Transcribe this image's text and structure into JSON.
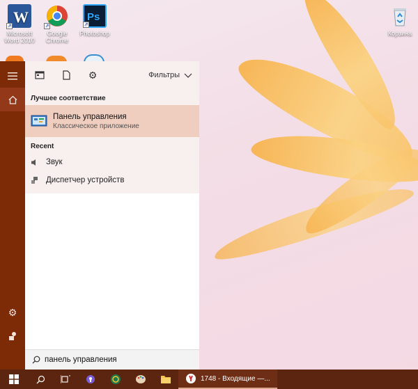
{
  "desktop": {
    "icons": [
      {
        "label": "Microsoft Word 2010"
      },
      {
        "label": "Google Chrome"
      },
      {
        "label": "Photoshop"
      },
      {
        "label": "Корзина"
      }
    ]
  },
  "panel": {
    "filters_label": "Фильтры",
    "best_match_header": "Лучшее соответствие",
    "best_match": {
      "title": "Панель управления",
      "subtitle": "Классическое приложение"
    },
    "recent_header": "Recent",
    "recent": [
      {
        "label": "Звук",
        "icon": "speaker-icon"
      },
      {
        "label": "Диспетчер устройств",
        "icon": "device-manager-icon"
      }
    ]
  },
  "search": {
    "query": "панель управления"
  },
  "taskbar": {
    "active_window_title": "1748 - Входящие —..."
  },
  "colors": {
    "rail": "#7d2a06",
    "taskbar": "#5c2510",
    "highlight": "#efcdbf",
    "panel_bg": "#f7f0ee"
  }
}
